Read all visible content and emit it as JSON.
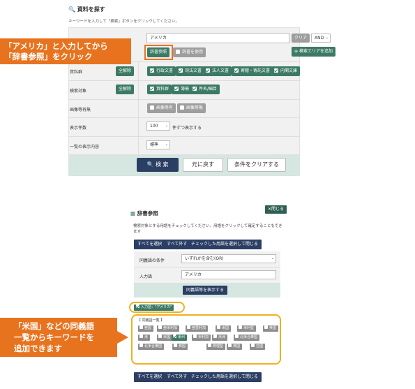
{
  "search_panel": {
    "title": "資料を探す",
    "instruction": "キーワードを入力して「検索」ボタンをクリックしてください。",
    "keyword_value": "アメリカ",
    "clear_label": "クリア",
    "operator_value": "AND",
    "dict_button": "辞書参照",
    "history_button": "辞書を使用",
    "add_area_button": "検索エリアを追加",
    "rows": {
      "collection_label": "資料群",
      "target_label": "検索対象",
      "image_label": "画像等有無",
      "count_label": "表示件数",
      "display_label": "一覧の表示内容"
    },
    "all_clear": "全解除",
    "collections": [
      "行政文書",
      "司法文書",
      "法人文書",
      "寄贈・寄託文書",
      "内閣文庫"
    ],
    "targets": [
      "資料群",
      "簿冊",
      "件名/細目"
    ],
    "image_options": [
      "画像等有",
      "画像等無"
    ],
    "count_value": "100",
    "count_suffix": "件ずつ表示する",
    "display_value": "標準",
    "search_button": "検 索",
    "back_button": "元に戻す",
    "reset_button": "条件をクリアする"
  },
  "callouts": {
    "top_line1": "「アメリカ」と入力してから",
    "top_line2": "「辞書参照」をクリック",
    "bottom_line1": "「米国」などの同義語",
    "bottom_line2": "一覧からキーワードを",
    "bottom_line3": "追加できます"
  },
  "dict_panel": {
    "title": "辞書参照",
    "close_label": "閉じる",
    "instruction": "検索対象とする用語をチェックしてください。用語をクリックして確定することもできます",
    "select_all": "すべてを選択",
    "deselect_all": "すべて外す",
    "apply_checked": "チェックした用語を選択して閉じる",
    "condition_label": "同義語の条件",
    "condition_value": "いずれかを含む(OR)",
    "input_label": "入力語",
    "input_value": "アメリカ",
    "show_synonyms": "同義語等を表示する",
    "input_word_chip": "入力語：\"アメリカ\"",
    "synonym_heading": "【 同義語一覧 】",
    "synonyms": [
      "亜国",
      "亜米利加",
      "亜墨利加",
      "米国",
      "米利堅",
      "美国",
      "米",
      "米国",
      "米州",
      "米利加",
      "米洲",
      "北米合衆国",
      "北米合衆国",
      "弗国",
      "弗理堅",
      "弗国",
      "亞國"
    ]
  },
  "colors": {
    "accent": "#e8731f",
    "green": "#3c7a65",
    "navy": "#2b3e63",
    "panel": "#f1f1f1"
  }
}
